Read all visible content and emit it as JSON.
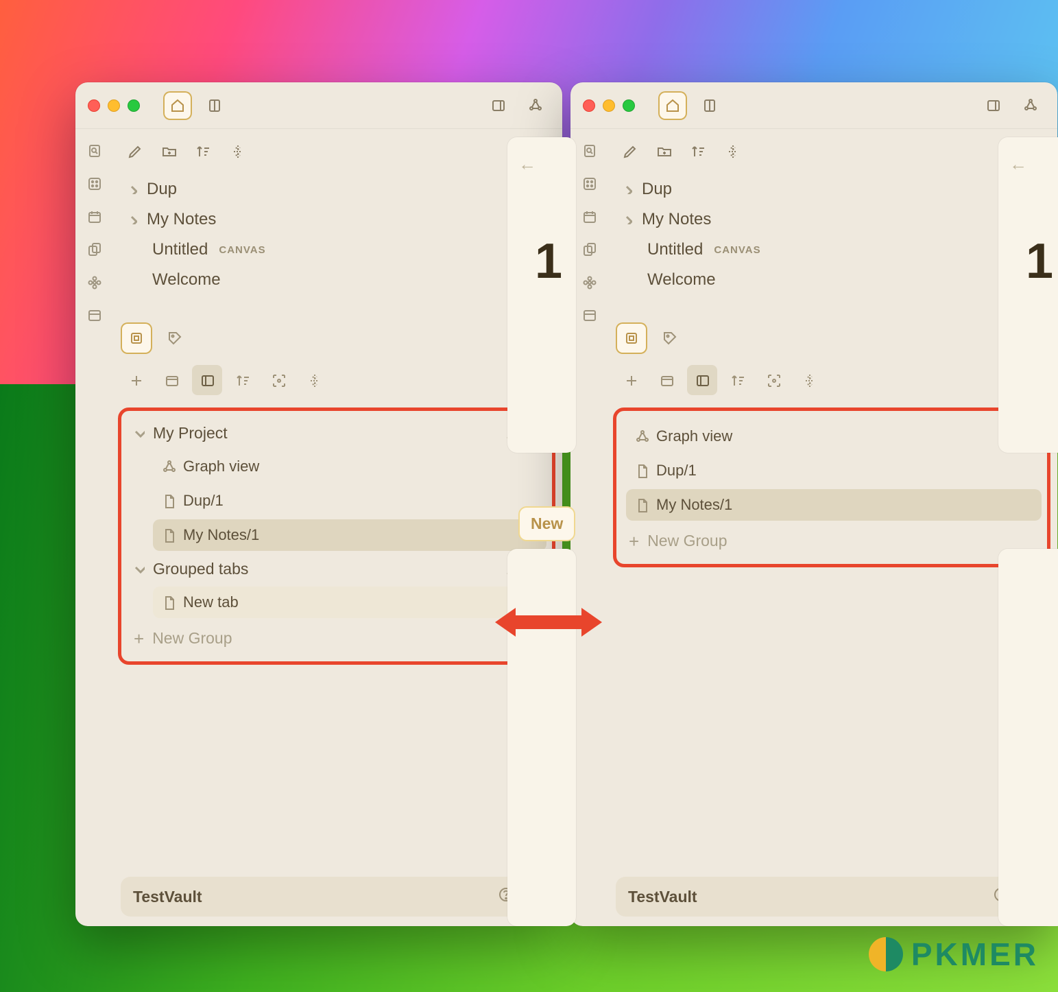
{
  "files": {
    "dup": "Dup",
    "my_notes": "My Notes",
    "untitled": "Untitled",
    "untitled_badge": "CANVAS",
    "welcome": "Welcome"
  },
  "left": {
    "groups": [
      {
        "name": "My Project",
        "items": [
          {
            "icon": "graph",
            "label": "Graph view"
          },
          {
            "icon": "file",
            "label": "Dup/1"
          },
          {
            "icon": "file",
            "label": "My Notes/1",
            "active": true
          }
        ]
      },
      {
        "name": "Grouped tabs",
        "items": [
          {
            "icon": "file",
            "label": "New tab",
            "soft": true
          }
        ]
      }
    ],
    "new_group": "New Group"
  },
  "right": {
    "items": [
      {
        "icon": "graph",
        "label": "Graph view"
      },
      {
        "icon": "file",
        "label": "Dup/1"
      },
      {
        "icon": "file",
        "label": "My Notes/1",
        "active": true
      }
    ],
    "new_group": "New Group"
  },
  "footer": {
    "vault": "TestVault"
  },
  "content": {
    "digit": "1",
    "new_label": "New"
  },
  "watermark": "PKMER"
}
